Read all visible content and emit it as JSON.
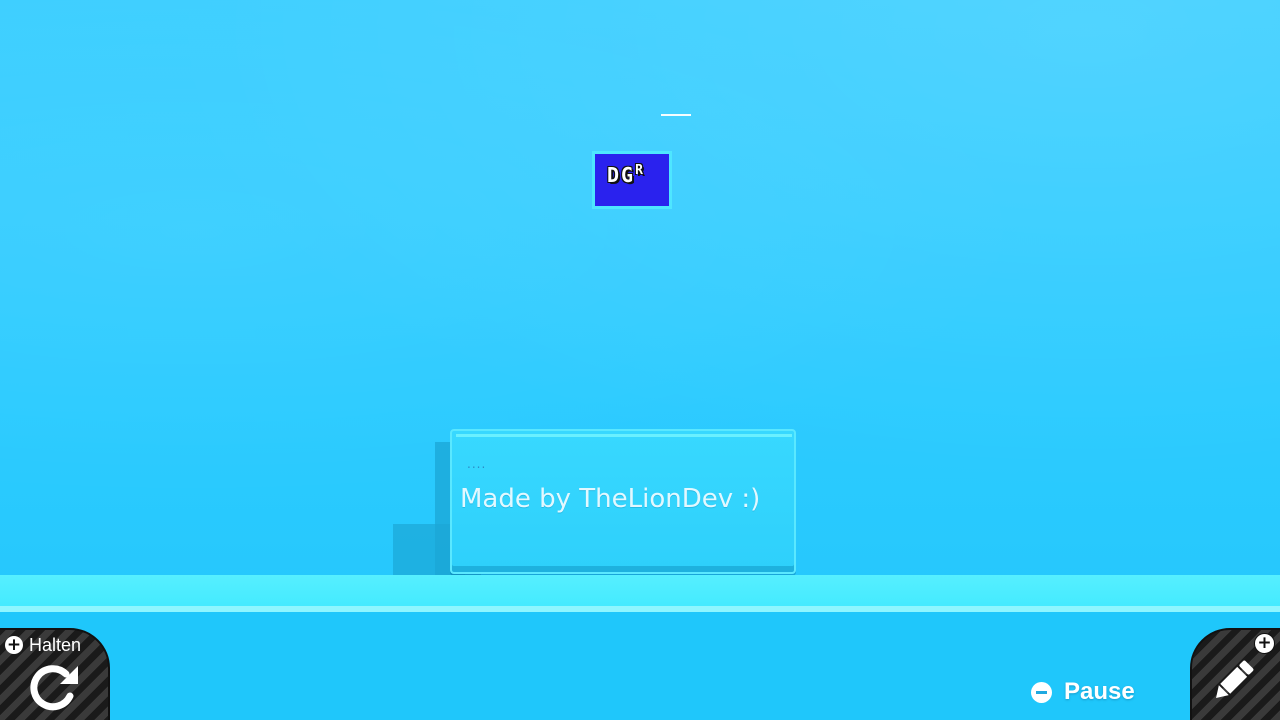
{
  "level": {
    "logo": {
      "letters": "DG",
      "superscript": "R",
      "background_color": "#2a22ee",
      "border_color": "#4ee6ff"
    },
    "sign": {
      "dots": "....",
      "text": "Made by TheLionDev :)"
    }
  },
  "hud": {
    "hold": {
      "plus_icon": "plus-circle-icon",
      "label": "Halten",
      "icon": "refresh-icon"
    },
    "pause": {
      "minus_icon": "minus-circle-icon",
      "label": "Pause"
    },
    "edit": {
      "plus_icon": "plus-circle-icon",
      "icon": "pencil-icon"
    }
  },
  "colors": {
    "sky": "#2ccbff",
    "ground_top": "#56efff",
    "ground_body": "#1fc7fb",
    "panel_stripes": "#1a1a1a"
  }
}
